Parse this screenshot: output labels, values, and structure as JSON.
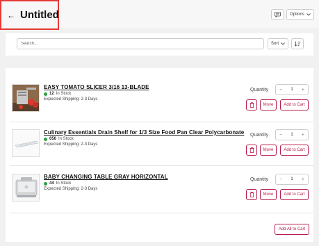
{
  "header": {
    "title": "Untitled",
    "options_label": "Options"
  },
  "toolbar": {
    "search_placeholder": "Search...",
    "sort_label": "Sort"
  },
  "items": [
    {
      "name": "EASY TOMATO SLICER 3/16 13-BLADE",
      "stock_count": "12",
      "stock_text": "In Stock",
      "shipping": "Expected Shipping: 2-3 Days",
      "quantity_label": "Quantity",
      "quantity": "1",
      "move_label": "Move",
      "cart_label": "Add to Cart",
      "thumb_icon": "tomato-slicer-image"
    },
    {
      "name": "Culinary Essentials Drain Shelf for 1/3 Size Food Pan Clear Polycarbonate",
      "stock_count": "656",
      "stock_text": "In Stock",
      "shipping": "Expected Shipping: 2-3 Days",
      "quantity_label": "Quantity",
      "quantity": "1",
      "move_label": "Move",
      "cart_label": "Add to Cart",
      "thumb_icon": "drain-shelf-image"
    },
    {
      "name": "BABY CHANGING TABLE GRAY HORIZONTAL",
      "stock_count": "44",
      "stock_text": "In Stock",
      "shipping": "Expected Shipping: 2-3 Days",
      "quantity_label": "Quantity",
      "quantity": "1",
      "move_label": "Move",
      "cart_label": "Add to Cart",
      "thumb_icon": "changing-table-image"
    }
  ],
  "footer": {
    "add_all_label": "Add All to Cart"
  },
  "colors": {
    "accent": "#b71c4a",
    "in_stock": "#2e9e44",
    "highlight_border": "#e53935"
  }
}
